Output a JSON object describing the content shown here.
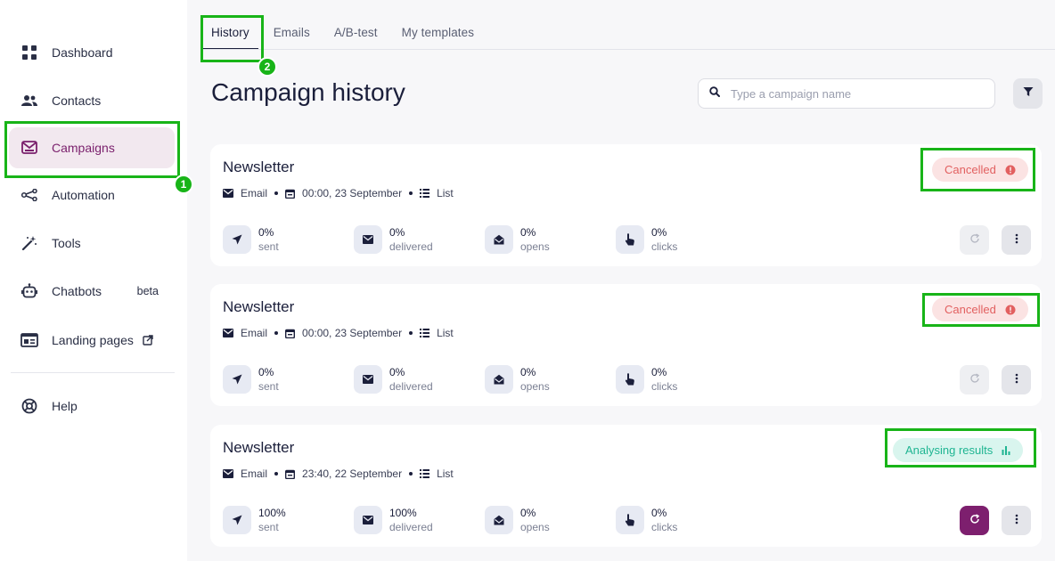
{
  "sidebar": {
    "items": [
      {
        "label": "Dashboard",
        "icon": "dashboard-icon"
      },
      {
        "label": "Contacts",
        "icon": "contacts-icon"
      },
      {
        "label": "Campaigns",
        "icon": "campaigns-icon",
        "active": true
      },
      {
        "label": "Automation",
        "icon": "automation-icon"
      },
      {
        "label": "Tools",
        "icon": "tools-icon"
      },
      {
        "label": "Chatbots",
        "icon": "chatbot-icon",
        "badge": "beta"
      },
      {
        "label": "Landing pages",
        "icon": "landing-pages-icon",
        "external": true
      },
      {
        "label": "Help",
        "icon": "help-icon"
      }
    ]
  },
  "annotations": {
    "step1": "1",
    "step2": "2"
  },
  "tabs": [
    {
      "label": "History",
      "active": true
    },
    {
      "label": "Emails"
    },
    {
      "label": "A/B-test"
    },
    {
      "label": "My templates"
    }
  ],
  "page": {
    "title": "Campaign history"
  },
  "search": {
    "placeholder": "Type a campaign name",
    "value": ""
  },
  "campaigns": [
    {
      "name": "Newsletter",
      "channel": "Email",
      "datetime": "00:00, 23 September",
      "recipients": "List",
      "status": "Cancelled",
      "status_kind": "cancelled",
      "stats": {
        "sent": {
          "value": "0%",
          "label": "sent"
        },
        "delivered": {
          "value": "0%",
          "label": "delivered"
        },
        "opens": {
          "value": "0%",
          "label": "opens"
        },
        "clicks": {
          "value": "0%",
          "label": "clicks"
        }
      }
    },
    {
      "name": "Newsletter",
      "channel": "Email",
      "datetime": "00:00, 23 September",
      "recipients": "List",
      "status": "Cancelled",
      "status_kind": "cancelled",
      "stats": {
        "sent": {
          "value": "0%",
          "label": "sent"
        },
        "delivered": {
          "value": "0%",
          "label": "delivered"
        },
        "opens": {
          "value": "0%",
          "label": "opens"
        },
        "clicks": {
          "value": "0%",
          "label": "clicks"
        }
      }
    },
    {
      "name": "Newsletter",
      "channel": "Email",
      "datetime": "23:40, 22 September",
      "recipients": "List",
      "status": "Analysing results",
      "status_kind": "analysing",
      "stats": {
        "sent": {
          "value": "100%",
          "label": "sent"
        },
        "delivered": {
          "value": "100%",
          "label": "delivered"
        },
        "opens": {
          "value": "0%",
          "label": "opens"
        },
        "clicks": {
          "value": "0%",
          "label": "clicks"
        }
      }
    }
  ],
  "colors": {
    "accent": "#7d1f6e",
    "active_nav_bg": "#f2e8ef",
    "cancelled_bg": "#fbe3e3",
    "cancelled_text": "#e26060",
    "analysing_bg": "#d9f5ee",
    "analysing_text": "#1fb592",
    "highlight": "#18b418"
  }
}
